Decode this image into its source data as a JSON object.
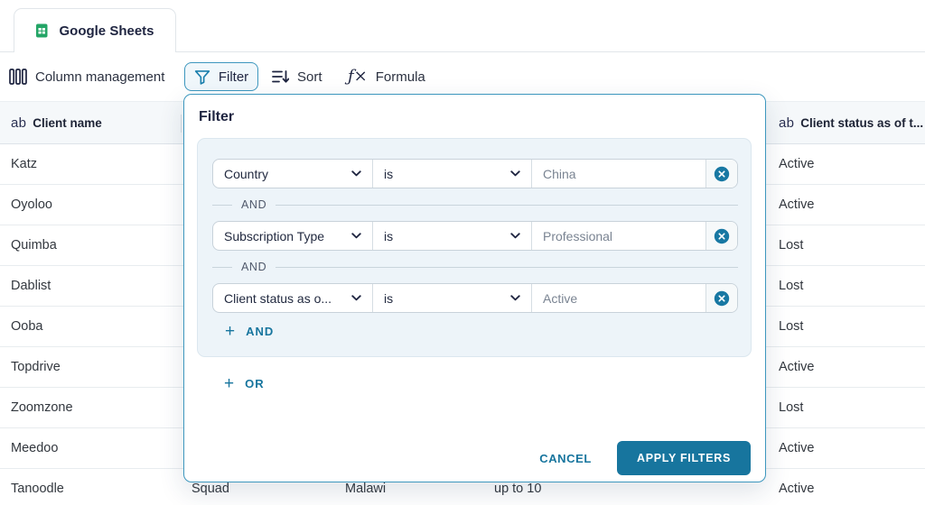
{
  "tab": {
    "label": "Google Sheets"
  },
  "toolbar": {
    "column_management_label": "Column management",
    "filter_label": "Filter",
    "sort_label": "Sort",
    "formula_label": "Formula",
    "formula_glyph": "ƒ×"
  },
  "table": {
    "header_left": {
      "icon": "ab",
      "label": "Client name"
    },
    "header_right": {
      "icon": "ab",
      "label": "Client status as of t..."
    },
    "rows": [
      {
        "client_name": "Katz",
        "status": "Active"
      },
      {
        "client_name": "Oyoloo",
        "status": "Active"
      },
      {
        "client_name": "Quimba",
        "status": "Lost"
      },
      {
        "client_name": "Dablist",
        "status": "Lost"
      },
      {
        "client_name": "Ooba",
        "status": "Lost"
      },
      {
        "client_name": "Topdrive",
        "status": "Active"
      },
      {
        "client_name": "Zoomzone",
        "status": "Lost"
      },
      {
        "client_name": "Meedoo",
        "status": "Active"
      },
      {
        "client_name": "Tanoodle",
        "status": "Active",
        "partial_cells": [
          "Squad",
          "Malawi",
          "up to 10"
        ]
      }
    ]
  },
  "filter_dialog": {
    "title": "Filter",
    "connector": "AND",
    "conditions": [
      {
        "field": "Country",
        "operator": "is",
        "value": "China"
      },
      {
        "field": "Subscription Type",
        "operator": "is",
        "value": "Professional"
      },
      {
        "field": "Client status as o...",
        "operator": "is",
        "value": "Active"
      }
    ],
    "plus_glyph": "+",
    "add_and_label": "AND",
    "add_or_label": "OR",
    "cancel_label": "CANCEL",
    "apply_label": "APPLY FILTERS"
  },
  "colors": {
    "accent": "#17759E",
    "dialog-border": "#3D97BE",
    "panel-bg": "#EDF4F9",
    "control-border": "#C8D2DA",
    "header-bg": "#F5F8FA",
    "navy": "#1E2440",
    "text": "#32373E",
    "muted": "#7A8492",
    "green": "#23A566"
  }
}
